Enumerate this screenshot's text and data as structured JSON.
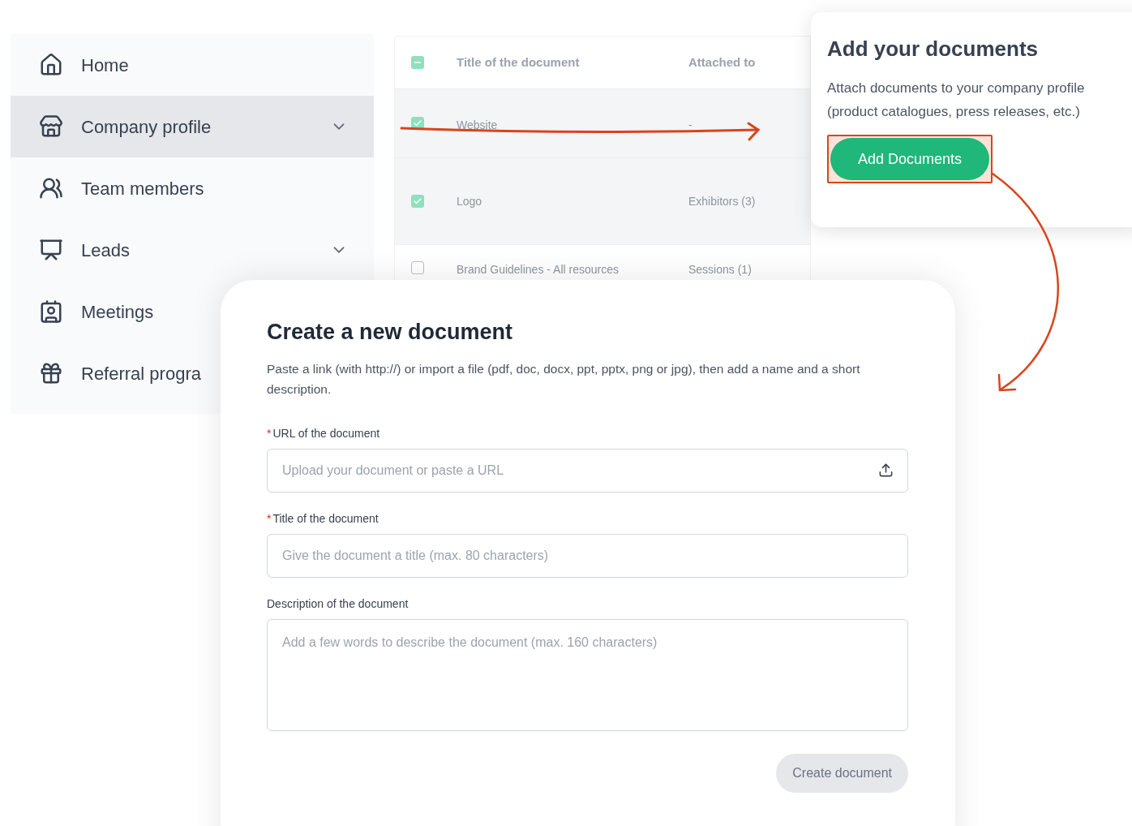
{
  "sidebar": {
    "items": [
      {
        "label": "Home",
        "selected": false,
        "expandable": false
      },
      {
        "label": "Company profile",
        "selected": true,
        "expandable": true
      },
      {
        "label": "Team members",
        "selected": false,
        "expandable": false
      },
      {
        "label": "Leads",
        "selected": false,
        "expandable": true
      },
      {
        "label": "Meetings",
        "selected": false
      },
      {
        "label": "Referral progra",
        "selected": false
      }
    ]
  },
  "table": {
    "columns": [
      "Title of the document",
      "Attached to"
    ],
    "header_checkbox": {
      "indeterminate": true
    },
    "rows": [
      {
        "title": "Website",
        "attached_to": "-",
        "checked": true
      },
      {
        "title": "Logo",
        "attached_to": "Exhibitors (3)",
        "checked": true
      },
      {
        "title": "Brand Guidelines - All resources",
        "attached_to": "Sessions (1)",
        "checked": false
      }
    ]
  },
  "popover": {
    "title": "Add your documents",
    "text": "Attach documents to your company profile (product catalogues, press releases, etc.)",
    "button": "Add Documents",
    "highlighted": true
  },
  "modal": {
    "title": "Create a new document",
    "description": "Paste a link (with http://) or import a file (pdf, doc, docx, ppt, pptx, png or jpg), then add a name and a short description.",
    "fields": [
      {
        "kind": "upload",
        "marker": "*",
        "label": "URL of the document",
        "placeholder": "Upload your document or paste a URL"
      },
      {
        "kind": "input",
        "marker": "*",
        "label": "Title of the document",
        "placeholder": "Give the document a title (max. 80 characters)"
      },
      {
        "kind": "textarea",
        "label": "Description of the document",
        "placeholder": "Add a few words to describe the document (max. 160 characters)"
      }
    ],
    "button": {
      "label": "Create document",
      "disabled": true
    }
  }
}
